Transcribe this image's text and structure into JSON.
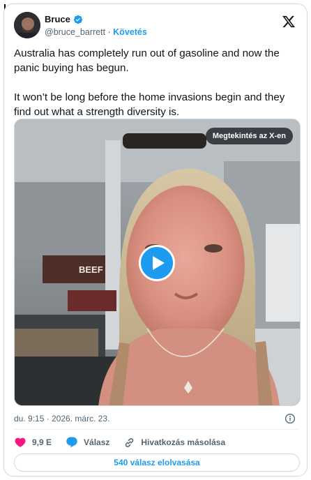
{
  "author": {
    "name": "Bruce",
    "handle": "@bruce_barrett",
    "separator": " · ",
    "follow_label": "Követés",
    "verified_color": "#1d9bf0"
  },
  "tweet": {
    "text": "Australia has completely run out of gasoline and now the panic buying has begun.\n\nIt won’t be long before the home invasions begin and they find out what a strength diversity is."
  },
  "media": {
    "view_on_x_label": "Megtekintés az X-en",
    "store_sign_text": "BEEF",
    "play_icon": "play-icon"
  },
  "meta": {
    "timestamp": "du. 9:15 · 2026. márc. 23."
  },
  "actions": {
    "likes_count": "9,9 E",
    "reply_label": "Válasz",
    "copy_link_label": "Hivatkozás másolása"
  },
  "replies_button_label": "540 válasz elolvasása",
  "colors": {
    "accent": "#1d9bf0",
    "like": "#f91880",
    "text": "#0f1419",
    "muted": "#536471"
  }
}
